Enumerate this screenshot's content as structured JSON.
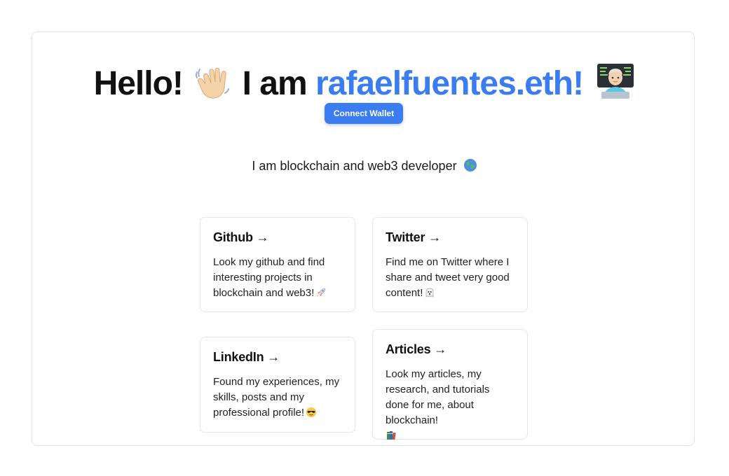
{
  "hero": {
    "greeting": "Hello!",
    "intro": "I am",
    "name": "rafaelfuentes.eth!",
    "wave_icon": "waving-hand-icon",
    "coder_icon": "technologist-icon"
  },
  "wallet": {
    "connect_label": "Connect Wallet"
  },
  "tagline": {
    "text": "I am blockchain and web3 developer",
    "icon": "globe-icon"
  },
  "cards": [
    {
      "title": "Github →",
      "description": "Look my github and find interesting projects in blockchain and web3!",
      "icon": "rocket-icon"
    },
    {
      "title": "Twitter →",
      "description": "Find me on Twitter where I share and tweet very good content!",
      "icon": "ghost-icon"
    },
    {
      "title": "LinkedIn →",
      "description": "Found my experiences, my skills, posts and my professional profile!",
      "icon": "sunglasses-face-icon"
    },
    {
      "title": "Articles →",
      "description": "Look my articles, my research, and tutorials done for me, about blockchain!",
      "icon": "books-icon"
    }
  ],
  "colors": {
    "accent": "#3b7cf0",
    "border": "#e3e3e3",
    "text": "#111111"
  }
}
